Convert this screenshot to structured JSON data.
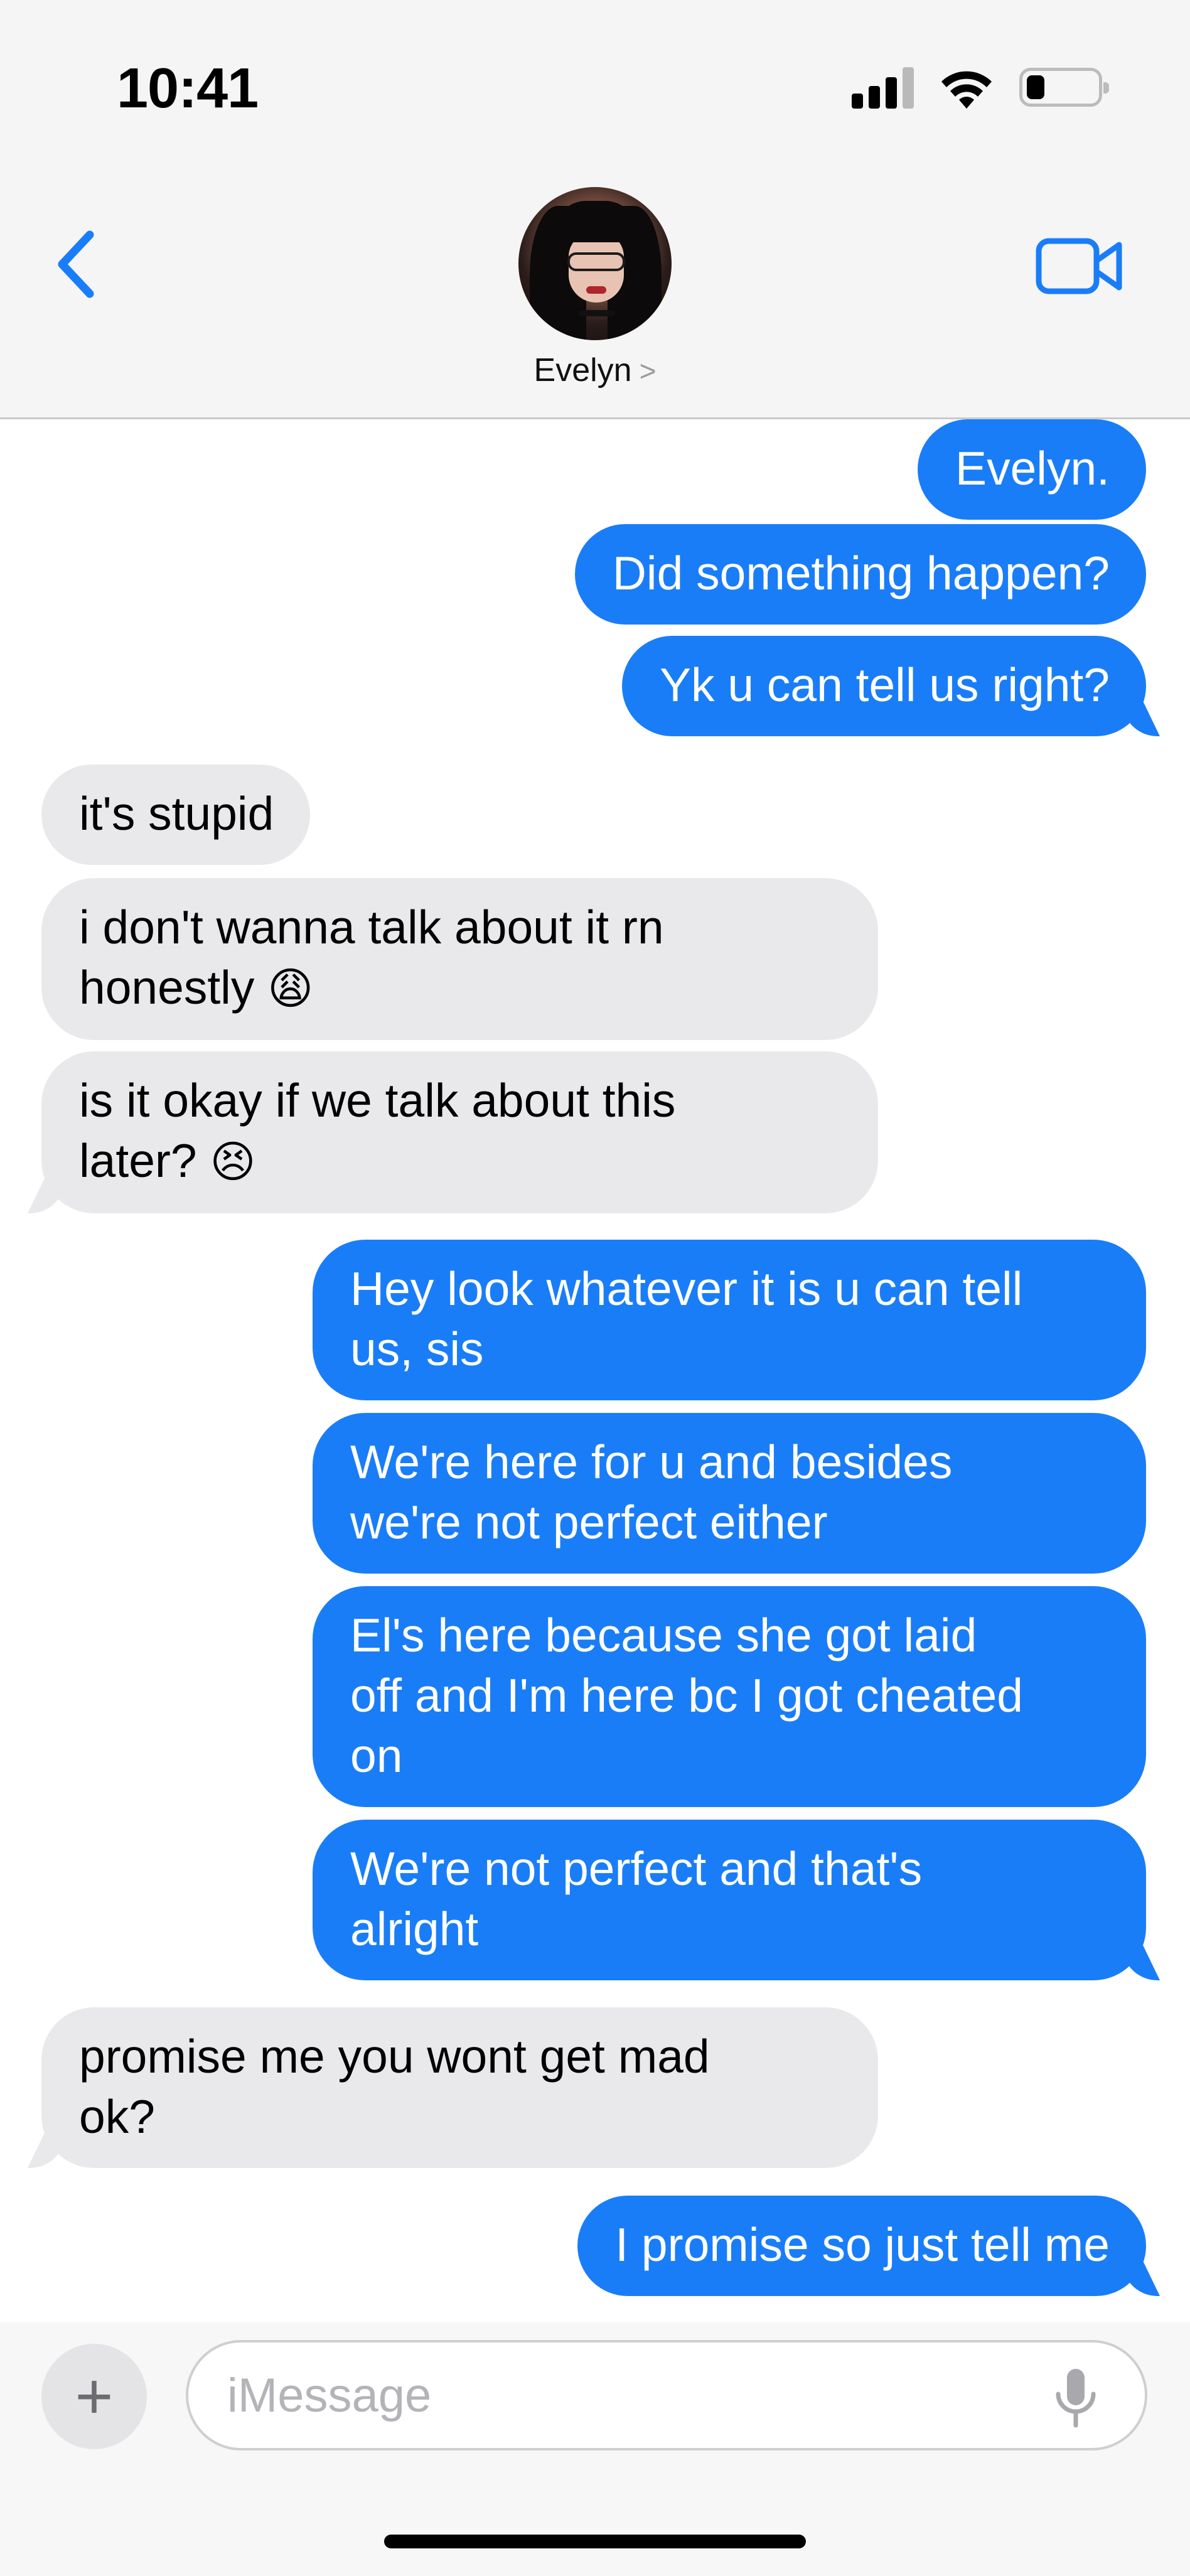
{
  "status_bar": {
    "time": "10:41"
  },
  "header": {
    "contact_name": "Evelyn",
    "name_chevron": ">"
  },
  "colors": {
    "accent": "#1A7DF8",
    "incoming_bubble": "#E9E9EB",
    "outgoing_text": "#FFFFFF"
  },
  "icons": [
    "chevron-left-icon",
    "video-camera-icon",
    "signal-icon",
    "wifi-icon",
    "battery-icon",
    "plus-icon",
    "microphone-icon"
  ],
  "messages": [
    {
      "from": "me",
      "lines": [
        "Evelyn."
      ]
    },
    {
      "from": "me",
      "lines": [
        "Did something happen?"
      ]
    },
    {
      "from": "me",
      "lines": [
        "Yk u can tell us right?"
      ]
    },
    {
      "from": "them",
      "lines": [
        "it's stupid"
      ]
    },
    {
      "from": "them",
      "lines": [
        "i don't wanna talk about it rn",
        "honestly"
      ],
      "emoji": "😩"
    },
    {
      "from": "them",
      "lines": [
        "is it okay if we talk about this",
        "later?"
      ],
      "emoji": "😣"
    },
    {
      "from": "me",
      "lines": [
        "Hey look whatever it is u can tell",
        "us, sis"
      ]
    },
    {
      "from": "me",
      "lines": [
        "We're here for u and besides",
        "we're not perfect either"
      ]
    },
    {
      "from": "me",
      "lines": [
        "El's here because she got laid",
        "off and I'm here bc I got cheated",
        "on"
      ]
    },
    {
      "from": "me",
      "lines": [
        "We're not perfect and that's",
        "alright"
      ]
    },
    {
      "from": "them",
      "lines": [
        "promise me you wont get mad",
        "ok?"
      ]
    },
    {
      "from": "me",
      "lines": [
        "I promise so just tell me"
      ]
    }
  ],
  "composer": {
    "placeholder": "iMessage",
    "value": "",
    "plus_label": "+"
  }
}
